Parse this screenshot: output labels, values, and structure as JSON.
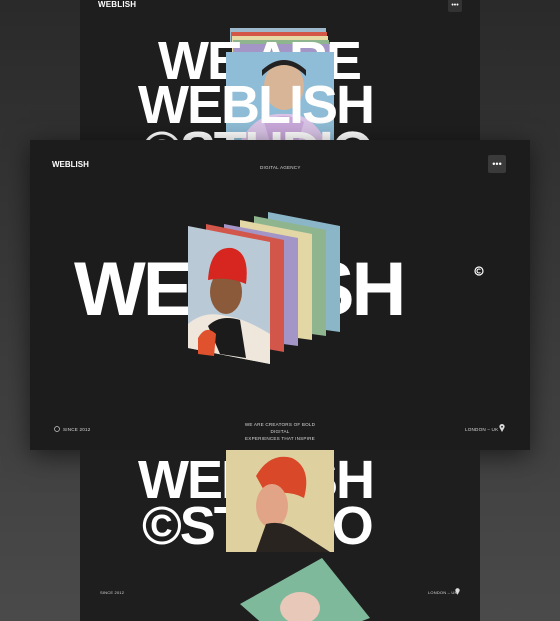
{
  "top": {
    "logo": "WEBLISH",
    "menu_icon": "ellipsis-icon",
    "line1": "WE ARE",
    "line2": "WEBLISH",
    "line3": "©STUDIO"
  },
  "main": {
    "logo": "WEBLISH",
    "nav_label": "DIGITAL AGENCY",
    "menu_icon": "ellipsis-icon",
    "hero_word": "WEBLISH",
    "copyright_icon": "copyright-icon",
    "since": "SINCE 2012",
    "tagline_line1": "WE ARE CREATORS OF BOLD DIGITAL",
    "tagline_line2": "EXPERIENCES THAT INSPIRE",
    "location": "LONDON – UK",
    "location_icon": "location-pin-icon",
    "card_colors": [
      "#8bb6c8",
      "#8fb58e",
      "#e2d7a5",
      "#a395c5",
      "#d2564a"
    ]
  },
  "bottom": {
    "line1": "WEBLISH",
    "line2": "©STUDIO",
    "since": "SINCE 2012",
    "location": "LONDON – UK"
  }
}
